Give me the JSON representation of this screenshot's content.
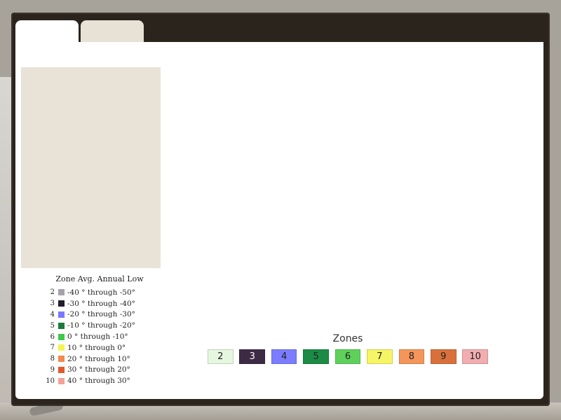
{
  "colors": {
    "frame": "#2a241d",
    "panel": "#e9e3d7",
    "tab_inactive": "#e7e1d6",
    "content": "#ffffff"
  },
  "tabs": [
    {
      "label": ""
    },
    {
      "label": ""
    }
  ],
  "legend": {
    "title": "Zone Avg. Annual Low",
    "rows": [
      {
        "zone": "2",
        "color": "#a6a2ad",
        "range": "-40 ° through -50°"
      },
      {
        "zone": "3",
        "color": "#231d2b",
        "range": "-30 ° through -40°"
      },
      {
        "zone": "4",
        "color": "#7a78ff",
        "range": "-20 ° through -30°"
      },
      {
        "zone": "5",
        "color": "#1c7a3e",
        "range": "-10 ° through -20°"
      },
      {
        "zone": "6",
        "color": "#3fc94a",
        "range": "0 ° through -10°"
      },
      {
        "zone": "7",
        "color": "#f4f452",
        "range": "10 ° through 0°"
      },
      {
        "zone": "8",
        "color": "#f1894d",
        "range": "20 ° through 10°"
      },
      {
        "zone": "9",
        "color": "#e2592c",
        "range": "30 ° through 20°"
      },
      {
        "zone": "10",
        "color": "#f2a29a",
        "range": "40 ° through 30°"
      }
    ]
  },
  "zones": {
    "title": "Zones",
    "buttons": [
      {
        "label": "2",
        "color": "#e5f7df",
        "text_color": "#222222"
      },
      {
        "label": "3",
        "color": "#3d2b45",
        "text_color": "#ffffff"
      },
      {
        "label": "4",
        "color": "#7b7cff",
        "text_color": "#222222"
      },
      {
        "label": "5",
        "color": "#1b8b45",
        "text_color": "#222222"
      },
      {
        "label": "6",
        "color": "#5ed15a",
        "text_color": "#222222"
      },
      {
        "label": "7",
        "color": "#f5f566",
        "text_color": "#222222"
      },
      {
        "label": "8",
        "color": "#f4955a",
        "text_color": "#222222"
      },
      {
        "label": "9",
        "color": "#d9703c",
        "text_color": "#222222"
      },
      {
        "label": "10",
        "color": "#f1adb0",
        "text_color": "#222222"
      }
    ]
  }
}
